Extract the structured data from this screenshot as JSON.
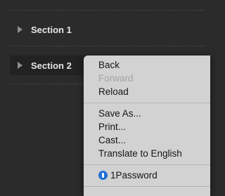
{
  "sections": [
    {
      "label": "Section 1",
      "icon": "disclosure-triangle-icon"
    },
    {
      "label": "Section 2",
      "icon": "disclosure-triangle-icon"
    }
  ],
  "context_menu": {
    "items": [
      {
        "label": "Back",
        "enabled": true
      },
      {
        "label": "Forward",
        "enabled": false
      },
      {
        "label": "Reload",
        "enabled": true
      },
      {
        "label": "Save As...",
        "enabled": true
      },
      {
        "label": "Print...",
        "enabled": true
      },
      {
        "label": "Cast...",
        "enabled": true
      },
      {
        "label": "Translate to English",
        "enabled": true
      },
      {
        "label": "1Password",
        "enabled": true,
        "icon": "1password-icon"
      }
    ]
  },
  "colors": {
    "background": "#2b2b2b",
    "menu_background": "#d2d2d2",
    "password_icon": "#1f6fd8"
  }
}
